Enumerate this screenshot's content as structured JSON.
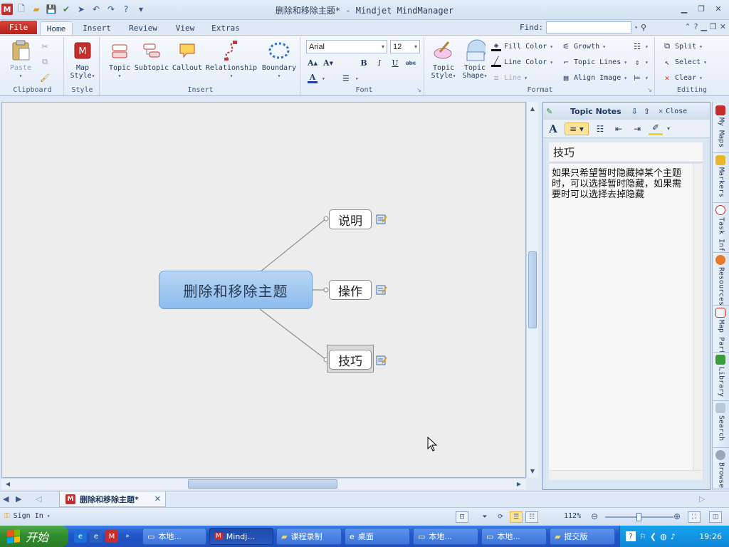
{
  "window": {
    "title": "删除和移除主题* - Mindjet MindManager",
    "app_icon": "M"
  },
  "tabs": [
    {
      "label": "File"
    },
    {
      "label": "Home"
    },
    {
      "label": "Insert"
    },
    {
      "label": "Review"
    },
    {
      "label": "View"
    },
    {
      "label": "Extras"
    }
  ],
  "find": {
    "label": "Find:",
    "value": ""
  },
  "ribbon": {
    "clipboard": {
      "label": "Clipboard",
      "paste": "Paste"
    },
    "style": {
      "label": "Style",
      "map_style_1": "Map",
      "map_style_2": "Style"
    },
    "insert": {
      "label": "Insert",
      "topic": "Topic",
      "subtopic": "Subtopic",
      "callout": "Callout",
      "relationship": "Relationship",
      "boundary": "Boundary"
    },
    "font": {
      "label": "Font",
      "family": "Arial",
      "size": "12"
    },
    "format": {
      "label": "Format",
      "topic_style_1": "Topic",
      "topic_style_2": "Style",
      "topic_shape_1": "Topic",
      "topic_shape_2": "Shape",
      "fill_color": "Fill Color",
      "line_color": "Line Color",
      "line": "Line",
      "growth": "Growth",
      "topic_lines": "Topic Lines",
      "align_image": "Align Image"
    },
    "editing": {
      "label": "Editing",
      "split": "Split",
      "select": "Select",
      "clear": "Clear"
    }
  },
  "map": {
    "central": "删除和移除主题",
    "subtopics": [
      {
        "label": "说明"
      },
      {
        "label": "操作"
      },
      {
        "label": "技巧"
      }
    ]
  },
  "notes": {
    "header": "Topic Notes",
    "close": "Close",
    "title": "技巧",
    "body": "如果只希望暂时隐藏掉某个主题时，可以选择暂时隐藏，如果需要时可以选择去掉隐藏"
  },
  "side_tabs": [
    {
      "label": "My Maps"
    },
    {
      "label": "Markers"
    },
    {
      "label": "Task Info"
    },
    {
      "label": "Resources"
    },
    {
      "label": "Map Parts"
    },
    {
      "label": "Library"
    },
    {
      "label": "Search"
    },
    {
      "label": "Browser"
    }
  ],
  "document_tab": {
    "label": "删除和移除主题*"
  },
  "status": {
    "sign_in": "Sign In",
    "zoom": "112%"
  },
  "taskbar": {
    "start": "开始",
    "tasks": [
      {
        "label": "本地..."
      },
      {
        "label": "Mindj..."
      },
      {
        "label": "课程录制"
      },
      {
        "label": "桌面"
      },
      {
        "label": "本地..."
      },
      {
        "label": "本地..."
      },
      {
        "label": "提交版"
      }
    ],
    "clock": "19:26"
  },
  "colors": {
    "file_tab": "#c62d2d",
    "central_topic": "#9dc5f0",
    "taskbar": "#2157c9",
    "start_button": "#2f8a2c"
  }
}
